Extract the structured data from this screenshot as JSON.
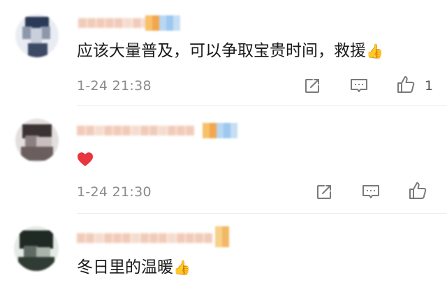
{
  "comments": [
    {
      "text": "应该大量普及，可以争取宝贵时间，救援",
      "text_emoji": "👍",
      "timestamp": "1-24 21:38",
      "like_count": "1",
      "username_blurred": true,
      "avatar_colors": [
        "#e9edf3",
        "#2b3a57",
        "#8d97ab",
        "#c9cfdb"
      ]
    },
    {
      "text": "",
      "text_emoji": "❤️",
      "timestamp": "1-24 21:30",
      "like_count": "",
      "username_blurred": true,
      "avatar_colors": [
        "#e3dfde",
        "#3b3233",
        "#8c7f80",
        "#c8bfbe"
      ]
    },
    {
      "text": "冬日里的温暖",
      "text_emoji": "👍",
      "timestamp": "",
      "like_count": "",
      "username_blurred": true,
      "avatar_colors": [
        "#e5eae6",
        "#1e2a23",
        "#5f6b62",
        "#a9b2ab"
      ]
    }
  ],
  "icons": {
    "share": "share-icon",
    "reply": "comment-icon",
    "like": "thumbs-up-icon"
  },
  "colors": {
    "timestamp": "#8a8a8a",
    "icon_stroke": "#7a7a7a",
    "divider": "#ececec",
    "heart": "#e8353e"
  }
}
